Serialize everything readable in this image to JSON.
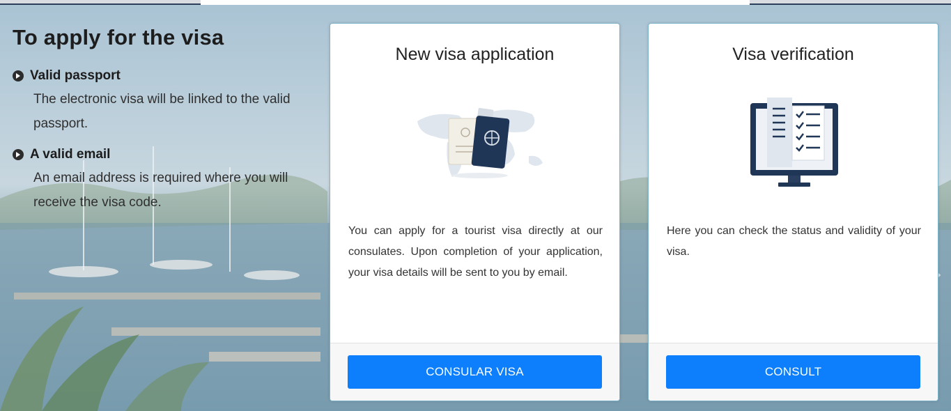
{
  "info": {
    "heading": "To apply for the visa",
    "requirements": [
      {
        "title": "Valid passport",
        "description": "The electronic visa will be linked to the valid passport."
      },
      {
        "title": "A valid email",
        "description": "An email address is required where you will receive the visa code."
      }
    ]
  },
  "cards": [
    {
      "title": "New visa application",
      "illustration_icon": "passport-world-map-icon",
      "text": "You can apply for a tourist visa directly at our consulates. Upon completion of your application, your visa details will be sent to you by email.",
      "button_label": "CONSULAR VISA"
    },
    {
      "title": "Visa verification",
      "illustration_icon": "monitor-checklist-icon",
      "text": "Here you can check the status and validity of your visa.",
      "button_label": "CONSULT"
    }
  ],
  "colors": {
    "button": "#0d7ffc",
    "card_border": "#7fb3c9",
    "heading": "#1d1d1d"
  }
}
